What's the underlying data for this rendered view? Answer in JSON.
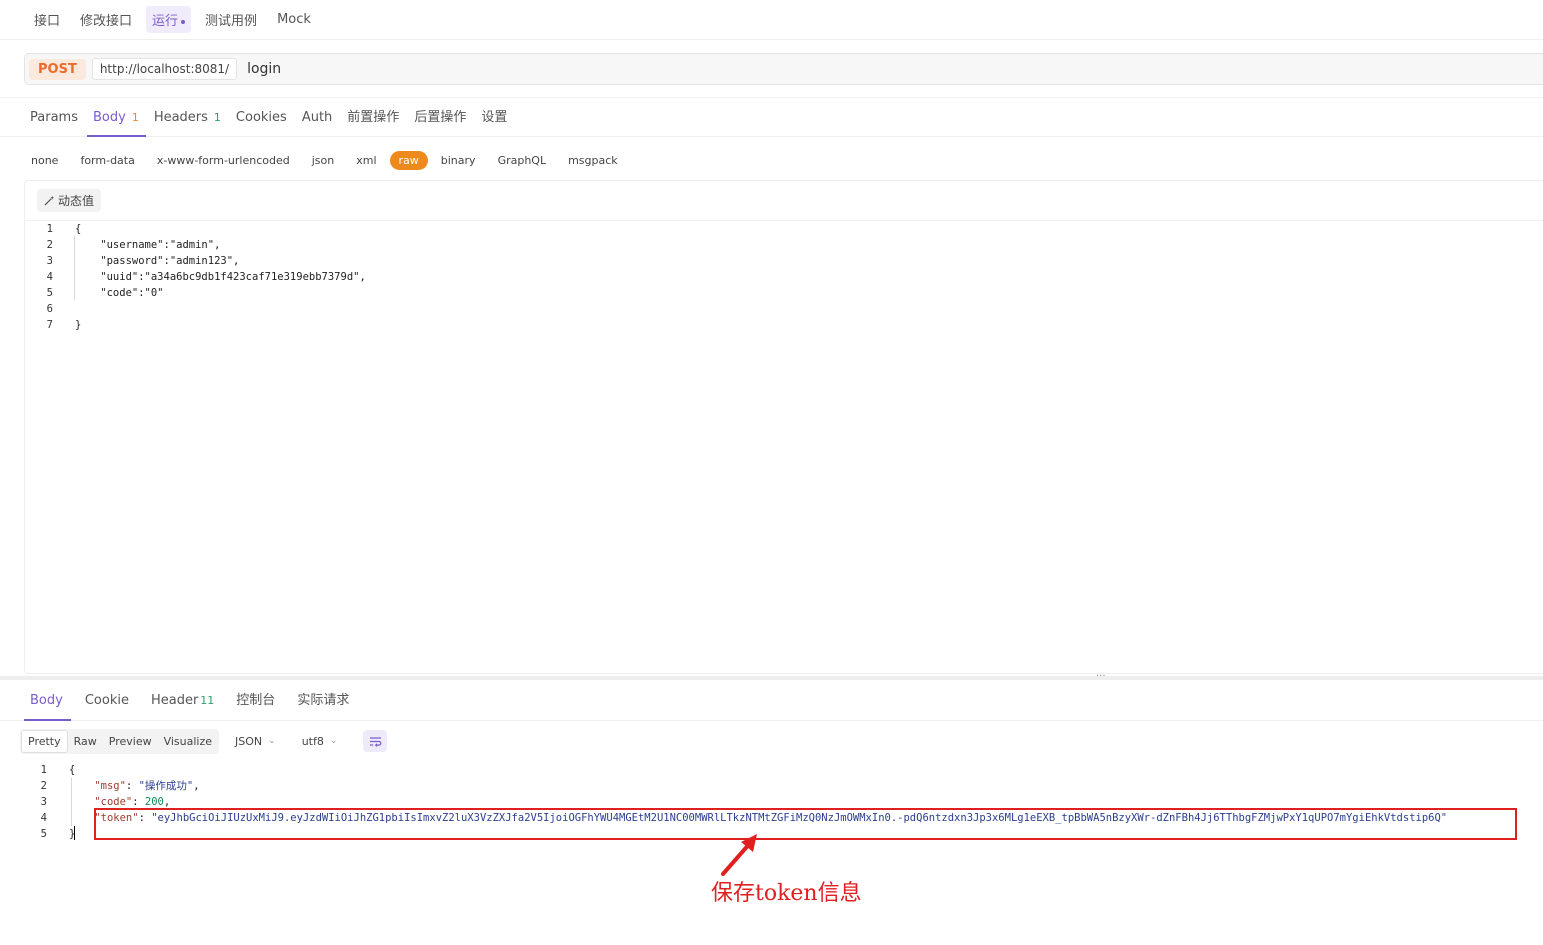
{
  "top_tabs": [
    "接口",
    "修改接口",
    "运行",
    "测试用例",
    "Mock"
  ],
  "request": {
    "method": "POST",
    "base_url": "http://localhost:8081/",
    "path": "login"
  },
  "request_tabs": [
    {
      "label": "Params",
      "badge": ""
    },
    {
      "label": "Body",
      "badge": "1"
    },
    {
      "label": "Headers",
      "badge": "1"
    },
    {
      "label": "Cookies",
      "badge": ""
    },
    {
      "label": "Auth",
      "badge": ""
    },
    {
      "label": "前置操作",
      "badge": ""
    },
    {
      "label": "后置操作",
      "badge": ""
    },
    {
      "label": "设置",
      "badge": ""
    }
  ],
  "body_types": [
    "none",
    "form-data",
    "x-www-form-urlencoded",
    "json",
    "xml",
    "raw",
    "binary",
    "GraphQL",
    "msgpack"
  ],
  "dynamic_value_label": "动态值",
  "request_body_lines": [
    {
      "n": "1",
      "text": "{"
    },
    {
      "n": "2",
      "text": "    \"username\":\"admin\","
    },
    {
      "n": "3",
      "text": "    \"password\":\"admin123\","
    },
    {
      "n": "4",
      "text": "    \"uuid\":\"a34a6bc9db1f423caf71e319ebb7379d\","
    },
    {
      "n": "5",
      "text": "    \"code\":\"0\""
    },
    {
      "n": "6",
      "text": ""
    },
    {
      "n": "7",
      "text": "}"
    }
  ],
  "split_dots": "···",
  "response_tabs": [
    {
      "label": "Body",
      "badge": ""
    },
    {
      "label": "Cookie",
      "badge": ""
    },
    {
      "label": "Header",
      "badge": "11"
    },
    {
      "label": "控制台",
      "badge": ""
    },
    {
      "label": "实际请求",
      "badge": ""
    }
  ],
  "view_modes": [
    "Pretty",
    "Raw",
    "Preview",
    "Visualize"
  ],
  "format_select": "JSON",
  "encoding_select": "utf8",
  "response": {
    "line_numbers": [
      "1",
      "2",
      "3",
      "4",
      "5"
    ],
    "open_brace": "{",
    "close_brace": "}",
    "msg_key": "\"msg\"",
    "msg_value": "\"操作成功\"",
    "code_key": "\"code\"",
    "code_value": "200",
    "token_key": "\"token\"",
    "token_value": "\"eyJhbGciOiJIUzUxMiJ9.eyJzdWIiOiJhZG1pbiIsImxvZ2luX3VzZXJfa2V5IjoiOGFhYWU4MGEtM2U1NC00MWRlLTkzNTMtZGFiMzQ0NzJmOWMxIn0.-pdQ6ntzdxn3Jp3x6MLg1eEXB_tpBbWA5nBzyXWr-dZnFBh4Jj6TThbgFZMjwPxY1qUPO7mYgiEhkVtdstip6Q\""
  },
  "annotation_text": "保存token信息",
  "colors": {
    "accent": "#7b5ccf",
    "method": "#ec6a2a",
    "raw_active": "#ed8a1b",
    "annotation": "#e02020"
  }
}
